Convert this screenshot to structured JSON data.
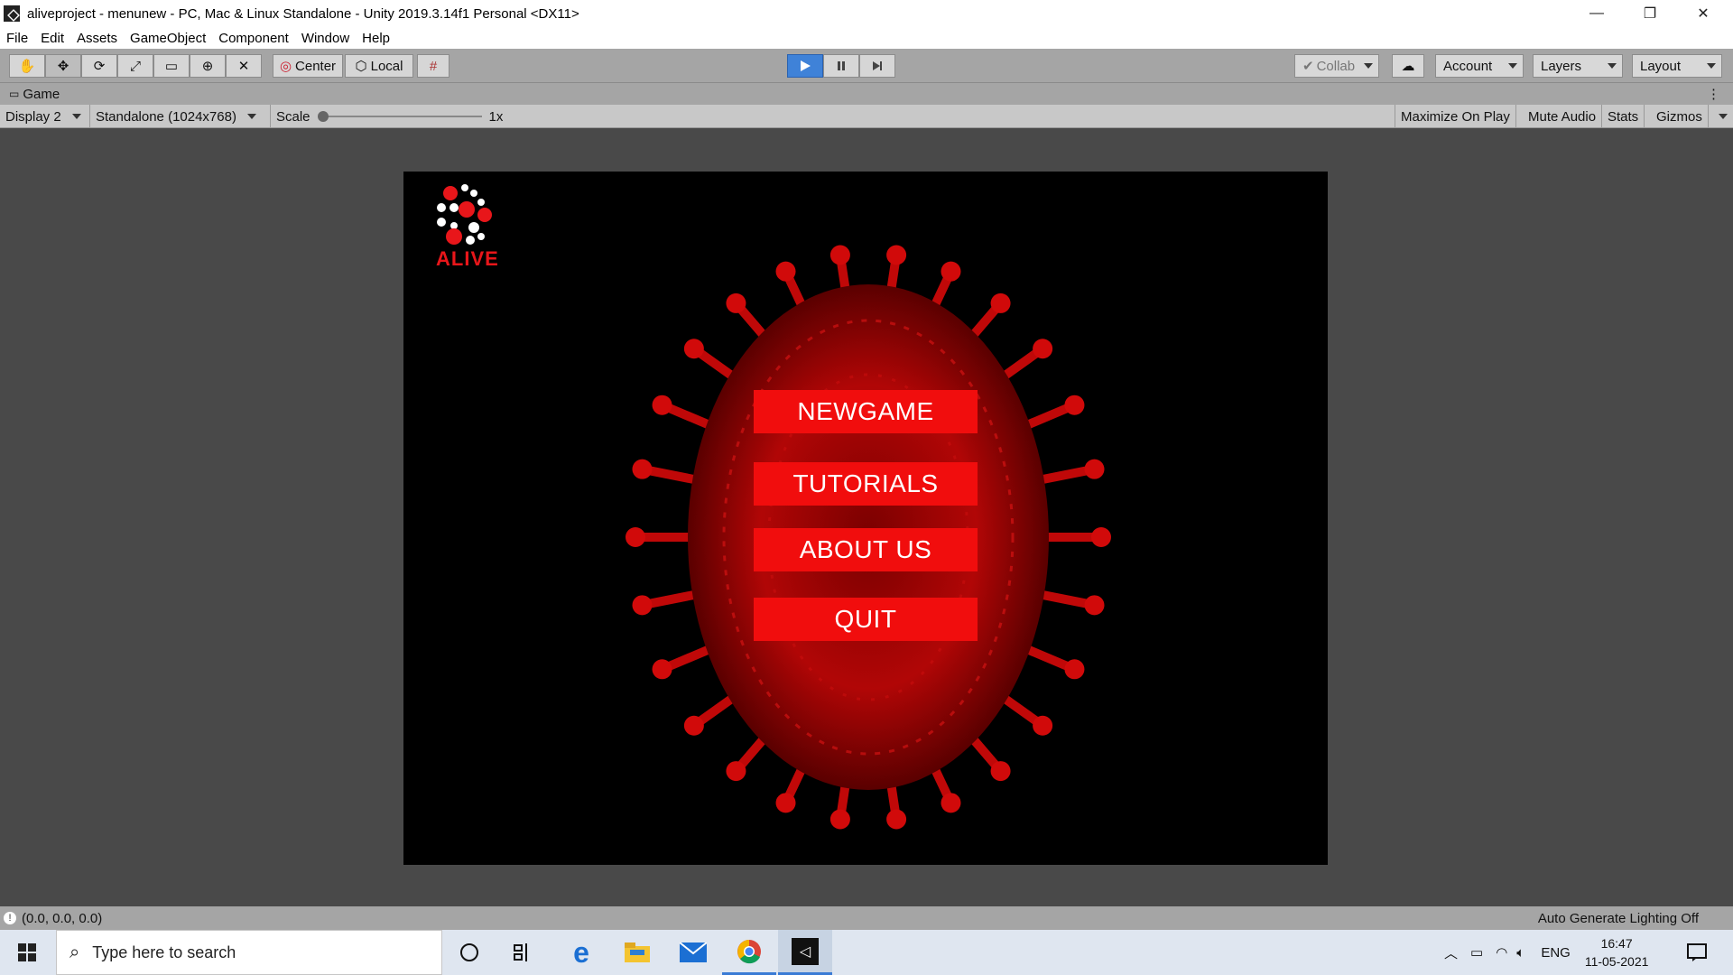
{
  "window": {
    "title": "aliveproject - menunew - PC, Mac & Linux Standalone - Unity 2019.3.14f1 Personal <DX11>",
    "controls": [
      "—",
      "❐",
      "✕"
    ]
  },
  "menu": [
    "File",
    "Edit",
    "Assets",
    "GameObject",
    "Component",
    "Window",
    "Help"
  ],
  "toolbar": {
    "pivot": "Center",
    "space": "Local",
    "collab": "Collab",
    "account": "Account",
    "layers": "Layers",
    "layout": "Layout"
  },
  "tab": {
    "label": "Game"
  },
  "gamebar": {
    "display": "Display 2",
    "resolution": "Standalone (1024x768)",
    "scale_label": "Scale",
    "scale_value": "1x",
    "scale_level": 0,
    "maximize": "Maximize On Play",
    "mute": "Mute Audio",
    "stats": "Stats",
    "gizmos": "Gizmos"
  },
  "game": {
    "logo_text": "ALIVE",
    "buttons": [
      "NEWGAME",
      "TUTORIALS",
      "ABOUT US",
      "QUIT"
    ],
    "accent": "#f10d0d",
    "virus_color": "#c00808"
  },
  "status": {
    "coords": "(0.0, 0.0, 0.0)",
    "lighting": "Auto Generate Lighting Off"
  },
  "taskbar": {
    "search_placeholder": "Type here to search",
    "language": "ENG",
    "time": "16:47",
    "date": "11-05-2021"
  }
}
